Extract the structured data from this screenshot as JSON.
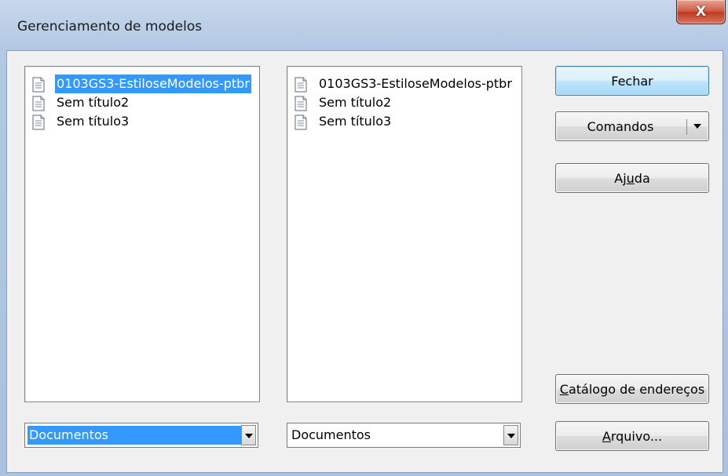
{
  "window": {
    "title": "Gerenciamento de modelos",
    "close_label": "X"
  },
  "left_list": {
    "items": [
      {
        "label": "0103GS3-EstiloseModelos-ptbr",
        "selected": true
      },
      {
        "label": "Sem título2",
        "selected": false
      },
      {
        "label": "Sem título3",
        "selected": false
      }
    ]
  },
  "right_list": {
    "items": [
      {
        "label": "0103GS3-EstiloseModelos-ptbr",
        "selected": false
      },
      {
        "label": "Sem título2",
        "selected": false
      },
      {
        "label": "Sem título3",
        "selected": false
      }
    ]
  },
  "buttons": {
    "close": "Fechar",
    "commands": "Comandos",
    "help_pre": "Aj",
    "help_ul": "u",
    "help_post": "da",
    "catalog_ul": "C",
    "catalog_rest": "atálogo de endereços",
    "file_ul": "A",
    "file_rest": "rquivo..."
  },
  "combos": {
    "left_value": "Documentos",
    "right_value": "Documentos"
  },
  "colors": {
    "selection": "#3399ff",
    "close_button": "#c0391f"
  },
  "icons": {
    "list_item": "document-icon",
    "dropdown": "chevron-down-icon"
  }
}
